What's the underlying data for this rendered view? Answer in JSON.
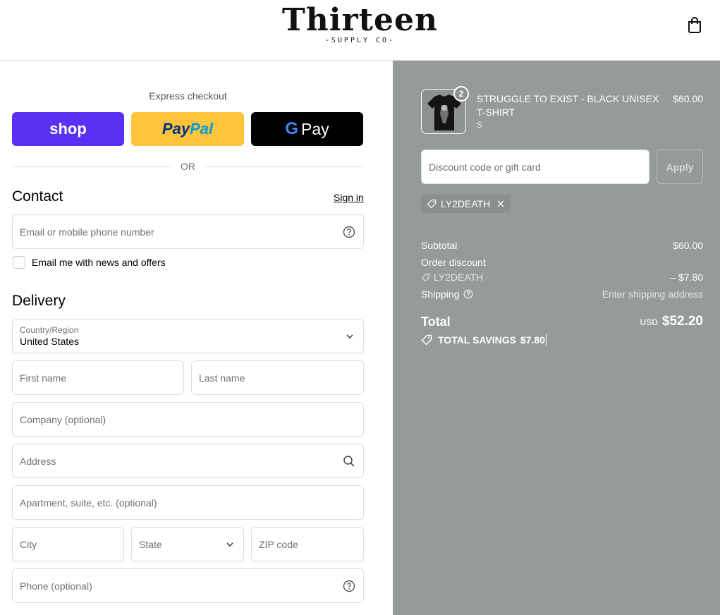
{
  "header": {
    "logo_title": "Thirteen",
    "logo_subtitle": "-SUPPLY CO-"
  },
  "express": {
    "label": "Express checkout",
    "shop_label": "shop",
    "paypal_part1": "Pay",
    "paypal_part2": "Pal",
    "gpay_g": "G",
    "gpay_label": "Pay",
    "or_label": "OR"
  },
  "contact": {
    "title": "Contact",
    "sign_in": "Sign in",
    "email_placeholder": "Email or mobile phone number",
    "news_label": "Email me with news and offers"
  },
  "delivery": {
    "title": "Delivery",
    "country_label": "Country/Region",
    "country_value": "United States",
    "first_name_placeholder": "First name",
    "last_name_placeholder": "Last name",
    "company_placeholder": "Company (optional)",
    "address_placeholder": "Address",
    "apartment_placeholder": "Apartment, suite, etc. (optional)",
    "city_placeholder": "City",
    "state_placeholder": "State",
    "zip_placeholder": "ZIP code",
    "phone_placeholder": "Phone (optional)"
  },
  "summary": {
    "product": {
      "name": "STRUGGLE TO EXIST - BLACK UNISEX T-SHIRT",
      "variant": "S",
      "price": "$60.00",
      "quantity": "2"
    },
    "discount_placeholder": "Discount code or gift card",
    "apply_label": "Apply",
    "applied_code": "LY2DEATH",
    "subtotal_label": "Subtotal",
    "subtotal_value": "$60.00",
    "order_discount_label": "Order discount",
    "order_discount_code": "LY2DEATH",
    "order_discount_value": "– $7.80",
    "shipping_label": "Shipping",
    "shipping_value": "Enter shipping address",
    "total_label": "Total",
    "total_currency": "USD",
    "total_value": "$52.20",
    "savings_label": "TOTAL SAVINGS",
    "savings_value": "$7.80"
  },
  "colors": {
    "shop_purple": "#5a31f4",
    "paypal_yellow": "#ffc439",
    "summary_bg": "#969b98"
  }
}
